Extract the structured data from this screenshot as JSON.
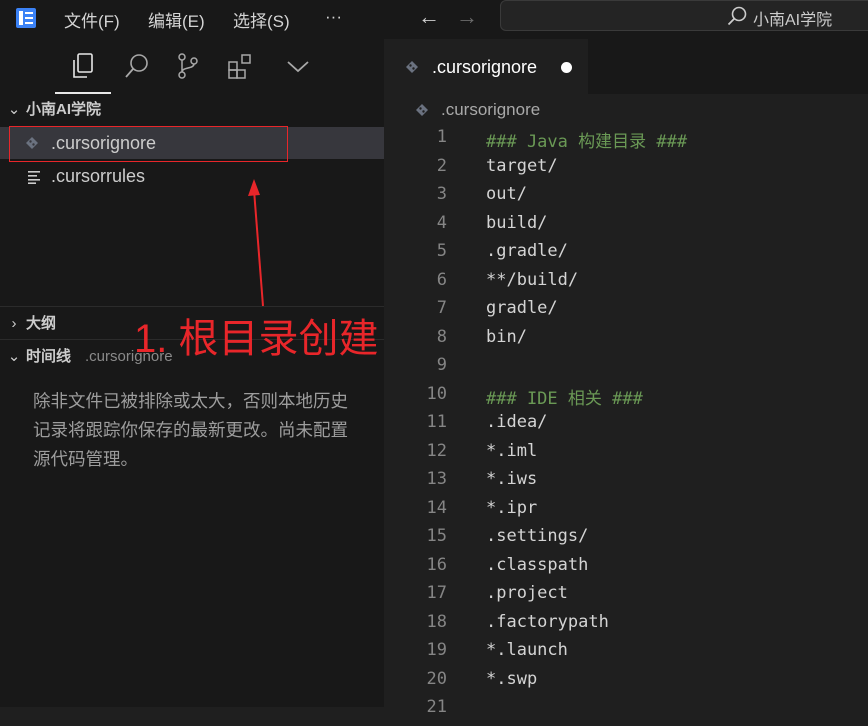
{
  "titlebar": {
    "menus": [
      "文件(F)",
      "编辑(E)",
      "选择(S)",
      "···"
    ],
    "search_text": "小南AI学院"
  },
  "explorer": {
    "folder_name": "小南AI学院",
    "files": [
      {
        "name": ".cursorignore",
        "icon": "git-diamond-icon",
        "selected": true
      },
      {
        "name": ".cursorrules",
        "icon": "lines-file-icon",
        "selected": false
      }
    ]
  },
  "outline": {
    "title": "大纲"
  },
  "timeline": {
    "title": "时间线",
    "file": ".cursorignore",
    "message": "除非文件已被排除或太大，否则本地历史记录将跟踪你保存的最新更改。尚未配置源代码管理。"
  },
  "annotation": {
    "text": "1. 根目录创建",
    "color": "#e8262a"
  },
  "editor": {
    "tab_label": ".cursorignore",
    "breadcrumb": ".cursorignore",
    "lines": [
      {
        "n": "1",
        "text": "### Java 构建目录 ###",
        "type": "comment"
      },
      {
        "n": "2",
        "text": "target/",
        "type": "text"
      },
      {
        "n": "3",
        "text": "out/",
        "type": "text"
      },
      {
        "n": "4",
        "text": "build/",
        "type": "text"
      },
      {
        "n": "5",
        "text": ".gradle/",
        "type": "text"
      },
      {
        "n": "6",
        "text": "**/build/",
        "type": "text"
      },
      {
        "n": "7",
        "text": "gradle/",
        "type": "text"
      },
      {
        "n": "8",
        "text": "bin/",
        "type": "text"
      },
      {
        "n": "9",
        "text": "",
        "type": "text"
      },
      {
        "n": "10",
        "text": "### IDE 相关 ###",
        "type": "comment"
      },
      {
        "n": "11",
        "text": ".idea/",
        "type": "text"
      },
      {
        "n": "12",
        "text": "*.iml",
        "type": "text"
      },
      {
        "n": "13",
        "text": "*.iws",
        "type": "text"
      },
      {
        "n": "14",
        "text": "*.ipr",
        "type": "text"
      },
      {
        "n": "15",
        "text": ".settings/",
        "type": "text"
      },
      {
        "n": "16",
        "text": ".classpath",
        "type": "text"
      },
      {
        "n": "17",
        "text": ".project",
        "type": "text"
      },
      {
        "n": "18",
        "text": ".factorypath",
        "type": "text"
      },
      {
        "n": "19",
        "text": "*.launch",
        "type": "text"
      },
      {
        "n": "20",
        "text": "*.swp",
        "type": "text"
      },
      {
        "n": "21",
        "text": "",
        "type": "text"
      }
    ]
  },
  "colors": {
    "comment": "#6a9955",
    "accent_red": "#e8262a"
  }
}
